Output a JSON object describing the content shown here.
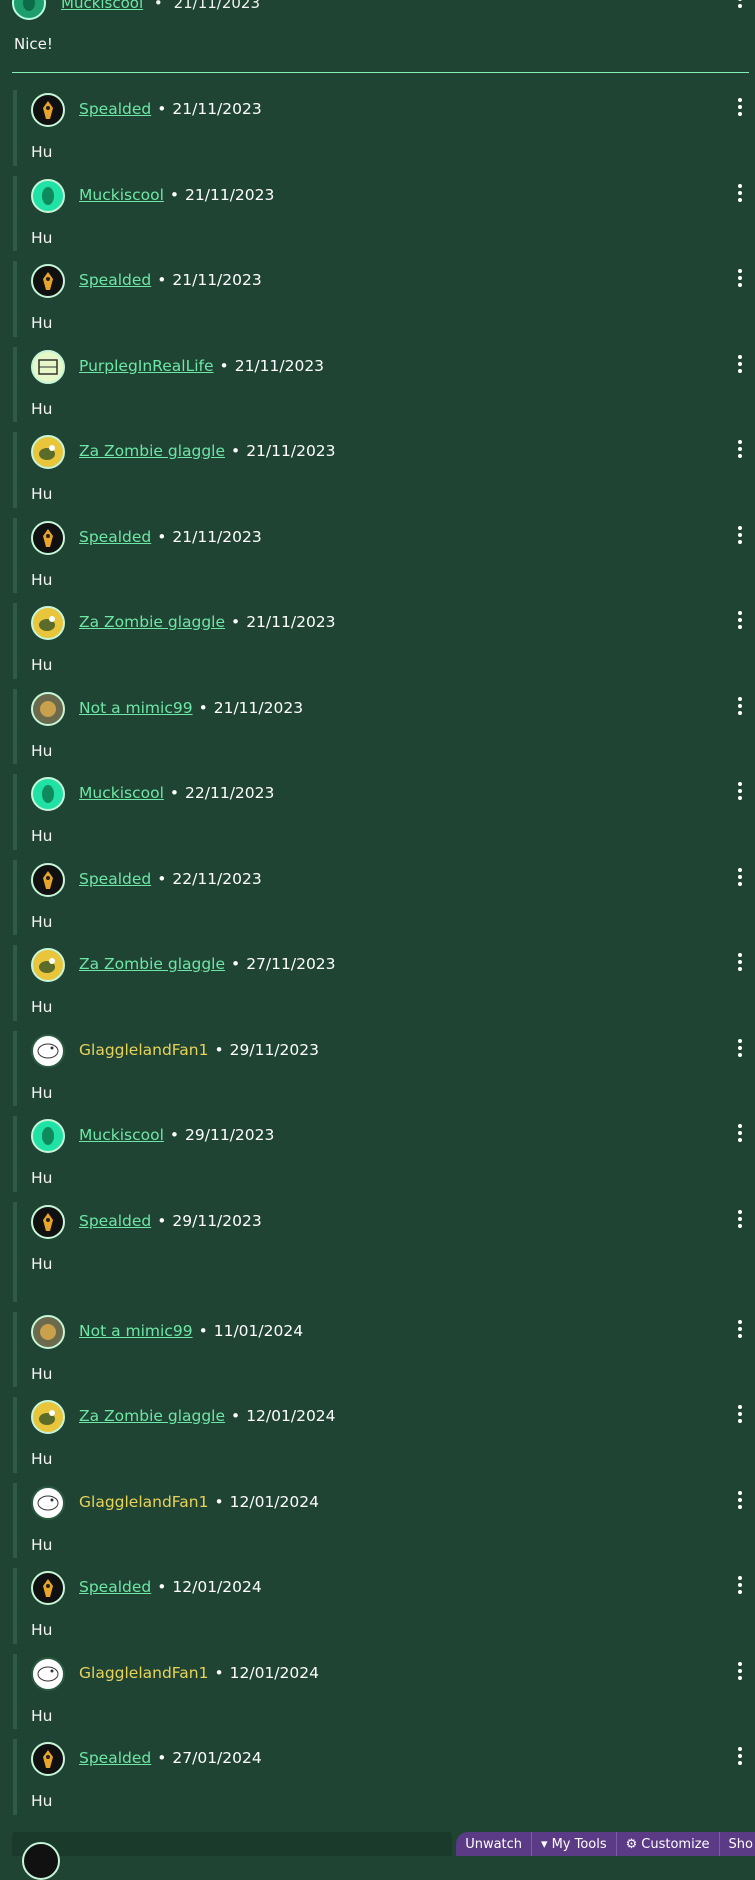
{
  "top_comment": {
    "author": "Muckiscool",
    "date": "21/11/2023",
    "body": "Nice!"
  },
  "separator": "•",
  "replies": [
    {
      "author": "Spealded",
      "date": "21/11/2023",
      "body": "Hu",
      "avatar": "spealded-avatar",
      "linked": true
    },
    {
      "author": "Muckiscool",
      "date": "21/11/2023",
      "body": "Hu",
      "avatar": "muckiscool-avatar",
      "linked": true
    },
    {
      "author": "Spealded",
      "date": "21/11/2023",
      "body": "Hu",
      "avatar": "spealded-avatar",
      "linked": true
    },
    {
      "author": "PurplegInRealLife",
      "date": "21/11/2023",
      "body": "Hu",
      "avatar": "purpleg-avatar",
      "linked": true
    },
    {
      "author": "Za Zombie glaggle",
      "date": "21/11/2023",
      "body": "Hu",
      "avatar": "zombie-avatar",
      "linked": true
    },
    {
      "author": "Spealded",
      "date": "21/11/2023",
      "body": "Hu",
      "avatar": "spealded-avatar",
      "linked": true
    },
    {
      "author": "Za Zombie glaggle",
      "date": "21/11/2023",
      "body": "Hu",
      "avatar": "zombie-avatar",
      "linked": true
    },
    {
      "author": "Not a mimic99",
      "date": "21/11/2023",
      "body": "Hu",
      "avatar": "mimic-avatar",
      "linked": true
    },
    {
      "author": "Muckiscool",
      "date": "22/11/2023",
      "body": "Hu",
      "avatar": "muckiscool-avatar",
      "linked": true
    },
    {
      "author": "Spealded",
      "date": "22/11/2023",
      "body": "Hu",
      "avatar": "spealded-avatar",
      "linked": true
    },
    {
      "author": "Za Zombie glaggle",
      "date": "27/11/2023",
      "body": "Hu",
      "avatar": "zombie-avatar",
      "linked": true
    },
    {
      "author": "GlagglelandFan1",
      "date": "29/11/2023",
      "body": "Hu",
      "avatar": "fan-avatar",
      "linked": false
    },
    {
      "author": "Muckiscool",
      "date": "29/11/2023",
      "body": "Hu",
      "avatar": "muckiscool-avatar",
      "linked": true
    },
    {
      "author": "Spealded",
      "date": "29/11/2023",
      "body": "Hu",
      "avatar": "spealded-avatar",
      "linked": true,
      "tall": true
    },
    {
      "author": "Not a mimic99",
      "date": "11/01/2024",
      "body": "Hu",
      "avatar": "mimic-avatar",
      "linked": true
    },
    {
      "author": "Za Zombie glaggle",
      "date": "12/01/2024",
      "body": "Hu",
      "avatar": "zombie-avatar",
      "linked": true
    },
    {
      "author": "GlagglelandFan1",
      "date": "12/01/2024",
      "body": "Hu",
      "avatar": "fan-avatar",
      "linked": false
    },
    {
      "author": "Spealded",
      "date": "12/01/2024",
      "body": "Hu",
      "avatar": "spealded-avatar",
      "linked": true
    },
    {
      "author": "GlagglelandFan1",
      "date": "12/01/2024",
      "body": "Hu",
      "avatar": "fan-avatar",
      "linked": false
    },
    {
      "author": "Spealded",
      "date": "27/01/2024",
      "body": "Hu",
      "avatar": "spealded-avatar",
      "linked": true
    }
  ],
  "toolbar": {
    "unwatch": "Unwatch",
    "my_tools": "My Tools",
    "customize": "Customize",
    "show": "Sho"
  },
  "colors": {
    "background": "#204433",
    "link": "#6ee7a6",
    "unlinked_author": "#e8d35a",
    "toolbar": "#5b3a86"
  }
}
